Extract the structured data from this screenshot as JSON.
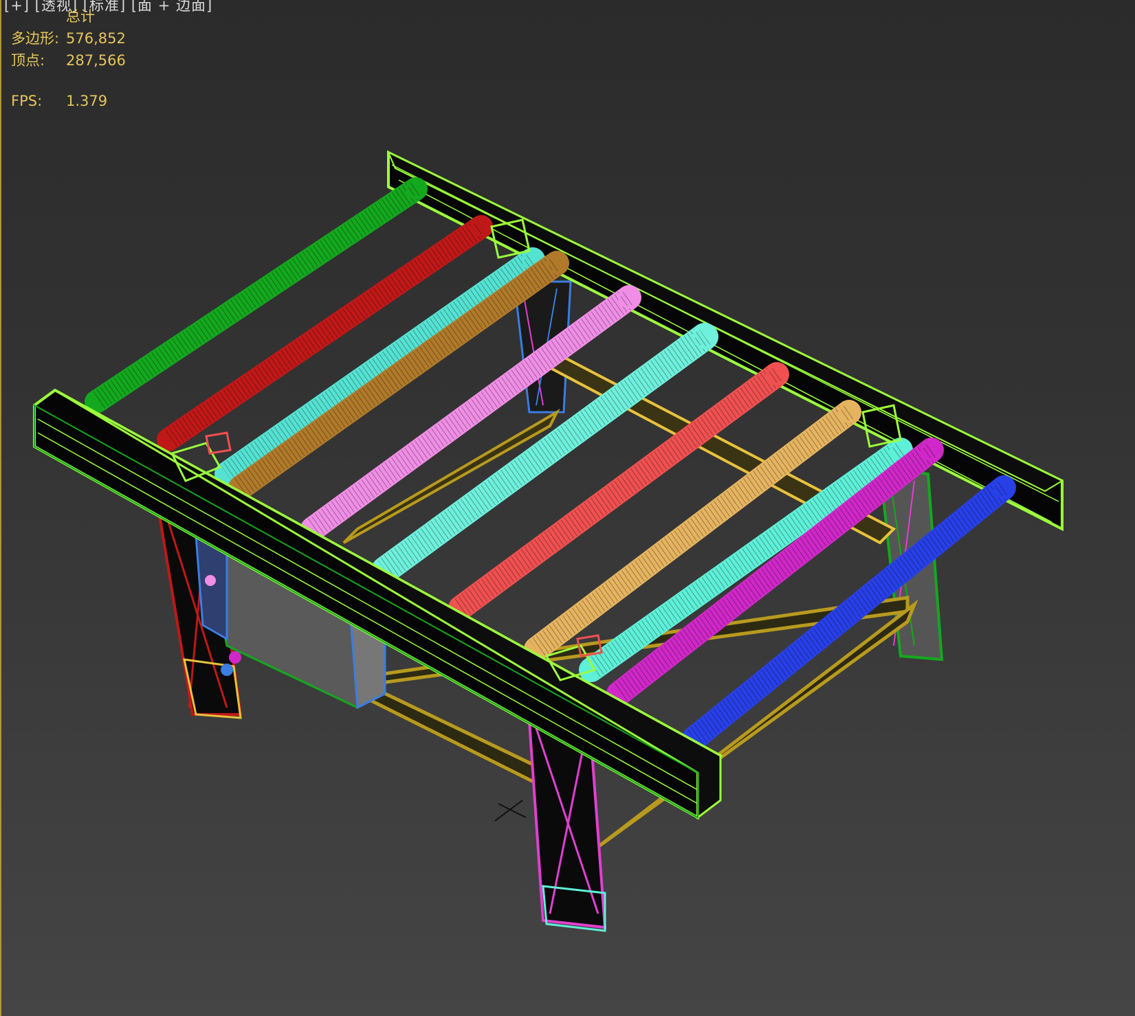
{
  "viewport": {
    "label_parts": [
      "[+]",
      "[透视]",
      "[标准]",
      "[面 + 边面]"
    ],
    "stats_header": "总计",
    "stats": [
      {
        "key": "多边形:",
        "value": "576,852"
      },
      {
        "key": "顶点:",
        "value": "287,566"
      },
      {
        "key": "FPS:",
        "value": "1.379"
      }
    ]
  },
  "colors": {
    "frame_wire": "#9cff3c",
    "rail_fill": "#050505",
    "yellow_wire": "#e8c23c",
    "olive_wire": "#b89a1e",
    "roller_colors": [
      "#14a81e",
      "#c01818",
      "#55e2d2",
      "#b07a2a",
      "#f08ee6",
      "#6ef0dc",
      "#f05050",
      "#e6b460",
      "#5ef0d8",
      "#d028c8",
      "#2840e8"
    ]
  }
}
